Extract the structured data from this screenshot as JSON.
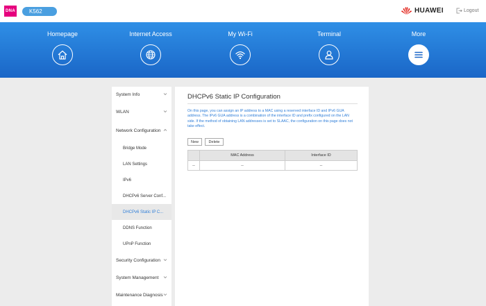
{
  "topbar": {
    "dna_logo": "DNA",
    "model": "K562",
    "brand": "HUAWEI",
    "logout": "Logout",
    "accent": "#4a9fe0",
    "brand_red": "#e2231a"
  },
  "nav": {
    "items": [
      {
        "label": "Homepage",
        "icon": "home-icon"
      },
      {
        "label": "Internet Access",
        "icon": "globe-icon"
      },
      {
        "label": "My Wi-Fi",
        "icon": "wifi-icon"
      },
      {
        "label": "Terminal",
        "icon": "user-icon"
      },
      {
        "label": "More",
        "icon": "menu-icon",
        "active": true
      }
    ],
    "gradient_top": "#2f8fe6",
    "gradient_bottom": "#1a66c7"
  },
  "sidebar": {
    "items": [
      {
        "label": "System Info",
        "level": "top",
        "chevron": "down"
      },
      {
        "label": "WLAN",
        "level": "top",
        "chevron": "down"
      },
      {
        "label": "Network Configuration",
        "level": "top",
        "chevron": "up"
      },
      {
        "label": "Bridge Mode",
        "level": "sub"
      },
      {
        "label": "LAN Settings",
        "level": "sub"
      },
      {
        "label": "IPv6",
        "level": "sub"
      },
      {
        "label": "DHCPv6 Server Conf...",
        "level": "sub"
      },
      {
        "label": "DHCPv6 Static IP C...",
        "level": "sub",
        "selected": true
      },
      {
        "label": "DDNS Function",
        "level": "sub"
      },
      {
        "label": "UPnP Function",
        "level": "sub"
      },
      {
        "label": "Security Configuration",
        "level": "top",
        "chevron": "down"
      },
      {
        "label": "System Management",
        "level": "top",
        "chevron": "down"
      },
      {
        "label": "Maintenance Diagnosis",
        "level": "top",
        "chevron": "down"
      }
    ]
  },
  "main": {
    "title": "DHCPv6 Static IP Configuration",
    "description": "On this page, you can assign an IP address to a MAC using a reserved interface ID and IPv6 GUA address. The IPv6 GUA address is a combination of the interface ID and prefix configured on the LAN side. If the method of obtaining LAN addresses is set to SLAAC, the configuration on this page does not take effect.",
    "buttons": {
      "new": "New",
      "delete": "Delete"
    },
    "table": {
      "columns": [
        "",
        "MAC Address",
        "Interface ID"
      ],
      "rows": [
        [
          "--",
          "--",
          "--"
        ]
      ]
    }
  }
}
